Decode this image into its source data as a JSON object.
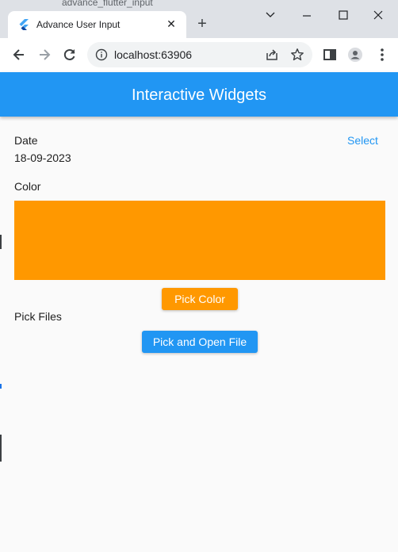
{
  "browser": {
    "background_tab_text": "advance_flutter_input",
    "tab_title": "Advance User Input",
    "address": "localhost:63906"
  },
  "app": {
    "title": "Interactive Widgets",
    "date_label": "Date",
    "date_value": "18-09-2023",
    "date_select_label": "Select",
    "color_label": "Color",
    "selected_color": "#ff9800",
    "pick_color_label": "Pick Color",
    "files_label": "Pick Files",
    "pick_file_label": "Pick and Open File"
  },
  "colors": {
    "primary": "#2196f3",
    "accent": "#ff9800"
  },
  "icons": {
    "favicon": "flutter-icon",
    "back": "back-arrow-icon",
    "forward": "forward-arrow-icon",
    "reload": "reload-icon",
    "site_info": "info-icon",
    "share": "share-icon",
    "bookmark": "star-icon",
    "side_panel": "side-panel-icon",
    "profile": "profile-icon",
    "menu": "kebab-menu-icon"
  }
}
